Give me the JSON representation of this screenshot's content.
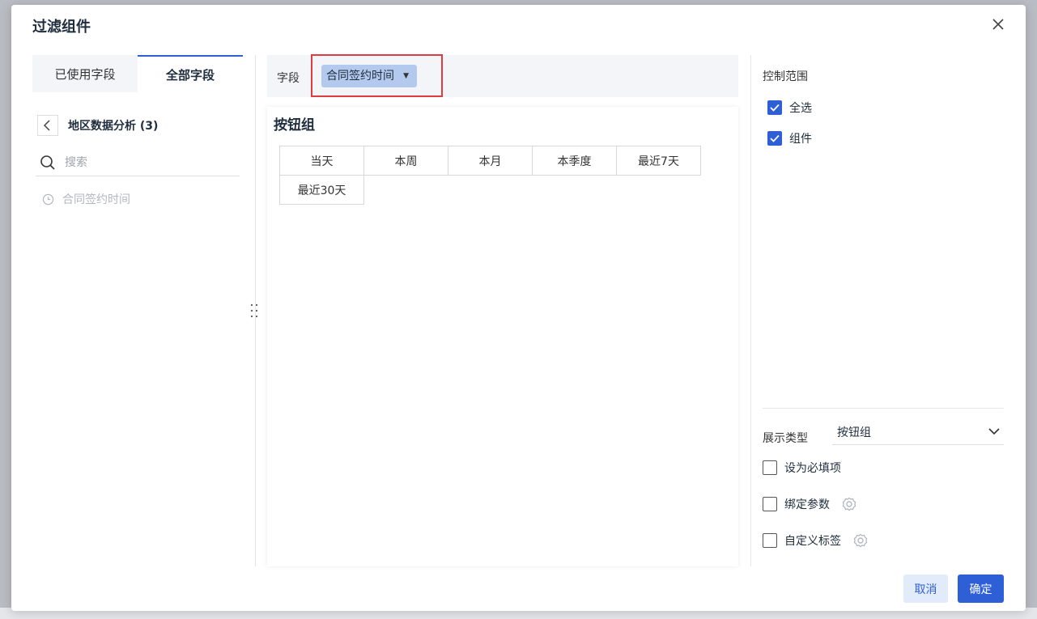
{
  "dialog": {
    "title": "过滤组件"
  },
  "left_panel": {
    "tabs": [
      {
        "label": "已使用字段",
        "active": false
      },
      {
        "label": "全部字段",
        "active": true
      }
    ],
    "breadcrumb": "地区数据分析 (3)",
    "search_placeholder": "搜索",
    "fields": [
      {
        "label": "合同签约时间",
        "icon": "clock-icon"
      }
    ]
  },
  "middle_panel": {
    "field_label": "字段",
    "selected_field": "合同签约时间",
    "preview_title": "按钮组",
    "buttons": [
      "当天",
      "本周",
      "本月",
      "本季度",
      "最近7天",
      "最近30天"
    ]
  },
  "right_panel": {
    "scope_title": "控制范围",
    "scope_options": [
      {
        "label": "全选",
        "checked": true
      },
      {
        "label": "组件",
        "checked": true
      }
    ],
    "display_type_label": "展示类型",
    "display_type_value": "按钮组",
    "options": [
      {
        "label": "设为必填项",
        "checked": false,
        "has_gear": false
      },
      {
        "label": "绑定参数",
        "checked": false,
        "has_gear": true
      },
      {
        "label": "自定义标签",
        "checked": false,
        "has_gear": true
      }
    ]
  },
  "footer": {
    "cancel_label": "取消",
    "ok_label": "确定"
  },
  "colors": {
    "accent": "#2f5fd7",
    "highlight": "#e23b3b",
    "chip": "#b3c9ee"
  }
}
